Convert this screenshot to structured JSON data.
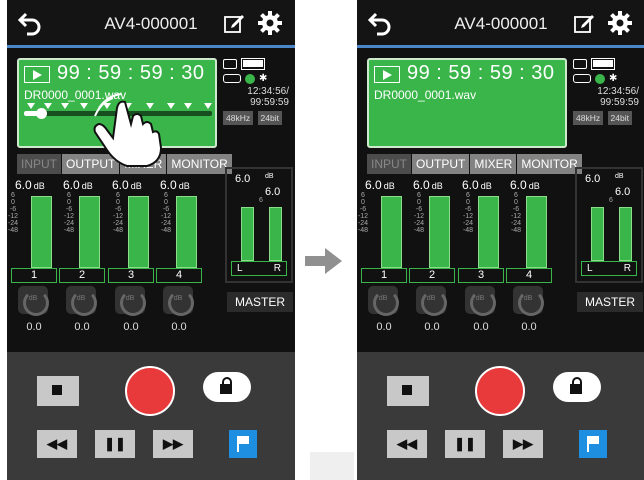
{
  "left": {
    "device_title": "AV4-000001",
    "timecode": "99 : 59 : 59 : 30",
    "filename": "DR0000_0001.wav",
    "playback_position": 0.09
  },
  "right": {
    "device_title": "AV4-000001",
    "timecode": "99 : 59 : 59 : 30",
    "filename": "DR0000_0001.wav"
  },
  "status": {
    "time": "12:34:56/",
    "remain": "99:59:59",
    "sample_rate": "48kHz",
    "bit_depth": "24bit"
  },
  "tabs": {
    "input": "INPUT",
    "output": "OUTPUT",
    "mixer": "MIXER",
    "monitor": "MONITOR"
  },
  "channels": {
    "db_value": "6.0",
    "db_unit": "dB",
    "labels": [
      "1",
      "2",
      "3",
      "4"
    ],
    "gains": [
      "0.0",
      "0.0",
      "0.0",
      "0.0"
    ],
    "dial_label": "dB",
    "scale": [
      "6",
      "0",
      "-6",
      "-12",
      "-24",
      "-48"
    ]
  },
  "master": {
    "label": "MASTER",
    "db_value": "6.0",
    "db_unit": "dB",
    "left": "L",
    "right": "R"
  },
  "colors": {
    "accent_green": "#3ab54a",
    "record_red": "#e83a3a",
    "mark_blue": "#1e8fe0",
    "title_underline": "#4a86c8"
  },
  "icons": [
    "back-arrow-icon",
    "edit-icon",
    "gear-icon",
    "play-icon",
    "usb-icon",
    "battery-icon",
    "sd-card-icon",
    "bluetooth-icon",
    "stop-icon",
    "record-icon",
    "unlock-icon",
    "rewind-icon",
    "pause-icon",
    "fast-forward-icon",
    "flag-icon",
    "tap-hand-icon",
    "arrow-right-icon"
  ]
}
